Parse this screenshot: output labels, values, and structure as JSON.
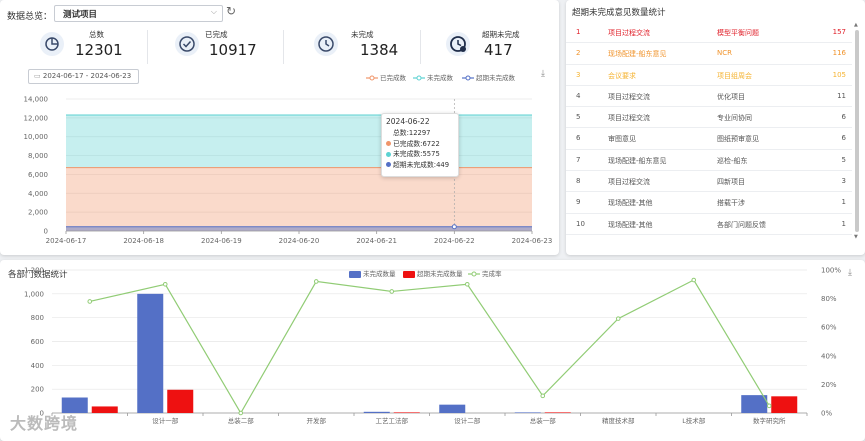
{
  "filter": {
    "label": "数据总览：",
    "selected": "测试项目"
  },
  "stats": [
    {
      "label": "总数",
      "value": "12301",
      "icon": "pie-chart-icon"
    },
    {
      "label": "已完成",
      "value": "10917",
      "icon": "check-circle-icon"
    },
    {
      "label": "未完成",
      "value": "1384",
      "icon": "clock-icon"
    },
    {
      "label": "超期未完成",
      "value": "417",
      "icon": "overdue-clock-icon"
    }
  ],
  "date_range": "2024-06-17  -  2024-06-23",
  "area_legend": [
    "已完成数",
    "未完成数",
    "超期未完成数"
  ],
  "tooltip": {
    "date": "2024-06-22",
    "total": "总数:12297",
    "completed": "已完成数:6722",
    "incomplete": "未完成数:5575",
    "overdue": "超期未完成数:449"
  },
  "right_panel": {
    "title": "超期未完成意见数量统计",
    "rows": [
      {
        "rank": "1",
        "type": "项目过程交流",
        "item": "模型平衡问题",
        "count": "157",
        "color": "#e0202a"
      },
      {
        "rank": "2",
        "type": "现场配建-船东意见",
        "item": "NCR",
        "count": "116",
        "color": "#f0932b"
      },
      {
        "rank": "3",
        "type": "会议要求",
        "item": "项目组周会",
        "count": "105",
        "color": "#f5b331"
      },
      {
        "rank": "4",
        "type": "项目过程交流",
        "item": "优化项目",
        "count": "11",
        "color": "#555555"
      },
      {
        "rank": "5",
        "type": "项目过程交流",
        "item": "专业间协同",
        "count": "6",
        "color": "#555555"
      },
      {
        "rank": "6",
        "type": "审图意见",
        "item": "图纸预审意见",
        "count": "6",
        "color": "#555555"
      },
      {
        "rank": "7",
        "type": "现场配建-船东意见",
        "item": "巡检-船东",
        "count": "5",
        "color": "#555555"
      },
      {
        "rank": "8",
        "type": "项目过程交流",
        "item": "四新项目",
        "count": "3",
        "color": "#555555"
      },
      {
        "rank": "9",
        "type": "现场配建-其他",
        "item": "搭载干涉",
        "count": "1",
        "color": "#555555"
      },
      {
        "rank": "10",
        "type": "现场配建-其他",
        "item": "各部门问题反馈",
        "count": "1",
        "color": "#555555"
      }
    ]
  },
  "bottom": {
    "title": "各部门数据统计"
  },
  "watermark": "大数跨境",
  "colors": {
    "completed": "#f0956a",
    "incomplete": "#5cd2d2",
    "overdue": "#5470c6",
    "bar_incomplete": "#5470c6",
    "bar_overdue": "#ee1111",
    "rate": "#91cc75"
  },
  "chart_data": [
    {
      "type": "area",
      "x": [
        "2024-06-17",
        "2024-06-18",
        "2024-06-19",
        "2024-06-20",
        "2024-06-21",
        "2024-06-22",
        "2024-06-23"
      ],
      "series": [
        {
          "name": "已完成数",
          "values": [
            6722,
            6722,
            6722,
            6722,
            6722,
            6722,
            6722
          ]
        },
        {
          "name": "未完成数",
          "values": [
            5575,
            5575,
            5575,
            5575,
            5575,
            5575,
            5575
          ]
        },
        {
          "name": "超期未完成数",
          "values": [
            449,
            449,
            449,
            449,
            449,
            449,
            449
          ]
        }
      ],
      "stacked_total": [
        12297,
        12297,
        12297,
        12297,
        12297,
        12297,
        12297
      ],
      "ylim": [
        0,
        14000
      ],
      "yticks": [
        "0",
        "2,000",
        "4,000",
        "6,000",
        "8,000",
        "10,000",
        "12,000",
        "14,000"
      ],
      "grid": true,
      "legend": "top-right"
    },
    {
      "type": "bar",
      "categories": [
        "设计一部",
        "总装二部",
        "开发部",
        "工艺工法部",
        "设计二部",
        "总装一部",
        "精度技术部",
        "L技术部",
        "数字研究所"
      ],
      "category_ticks": [
        "",
        "设计一部",
        "总装二部",
        "开发部",
        "工艺工法部",
        "设计二部",
        "总装一部",
        "精度技术部",
        "L技术部",
        "数字研究所"
      ],
      "series": [
        {
          "name": "未完成数量",
          "values": [
            130,
            1000,
            0,
            0,
            10,
            70,
            5,
            0,
            0,
            150
          ]
        },
        {
          "name": "超期未完成数量",
          "values": [
            55,
            195,
            0,
            0,
            5,
            0,
            5,
            0,
            0,
            140
          ]
        },
        {
          "name": "完成率",
          "values": [
            78,
            90,
            0,
            92,
            85,
            90,
            12,
            66,
            93,
            5
          ]
        }
      ],
      "ylim": [
        0,
        1200
      ],
      "yticks": [
        "0",
        "200",
        "400",
        "600",
        "800",
        "1,000",
        "1,200"
      ],
      "y2ticks": [
        "0%",
        "20%",
        "40%",
        "60%",
        "80%",
        "100%"
      ],
      "legend": [
        "未完成数量",
        "超期未完成数量",
        "完成率"
      ]
    }
  ]
}
